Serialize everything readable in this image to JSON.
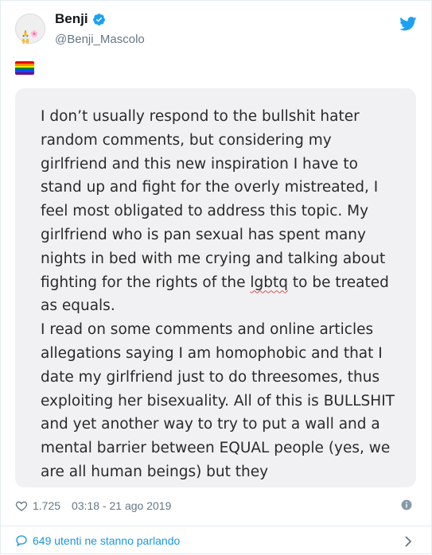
{
  "tweet": {
    "author": {
      "name": "Benji",
      "handle": "@Benji_Mascolo",
      "avatar_text": "🙏🌸🙌"
    },
    "text_emoji": "rainbow-flag-icon",
    "image_text": [
      "I don’t usually respond to the bullshit hater random comments, but considering my girlfriend and this new inspiration I have to stand up and fight for the overly mistreated, I feel most obligated to address this topic. My girlfriend who is pan sexual has spent many nights in bed with me crying and talking about fighting for the rights of the ",
      "lgbtq",
      " to be treated as equals.",
      "I read on some comments and online articles allegations saying I am homophobic and that I date my girlfriend just to do threesomes, thus exploiting her bisexuality. All of this is BULLSHIT and yet another way to try to put a wall and a mental barrier between EQUAL people (yes, we are all human beings) but they"
    ],
    "likes": "1.725",
    "timestamp": "03:18 - 21 ago 2019",
    "discussion": "649 utenti ne stanno parlando"
  },
  "colors": {
    "accent": "#1da1f2",
    "link": "#1b95e0",
    "muted": "#657786",
    "rainbow": [
      "#e40303",
      "#ff8c00",
      "#ffed00",
      "#008026",
      "#004dff",
      "#750787"
    ]
  }
}
